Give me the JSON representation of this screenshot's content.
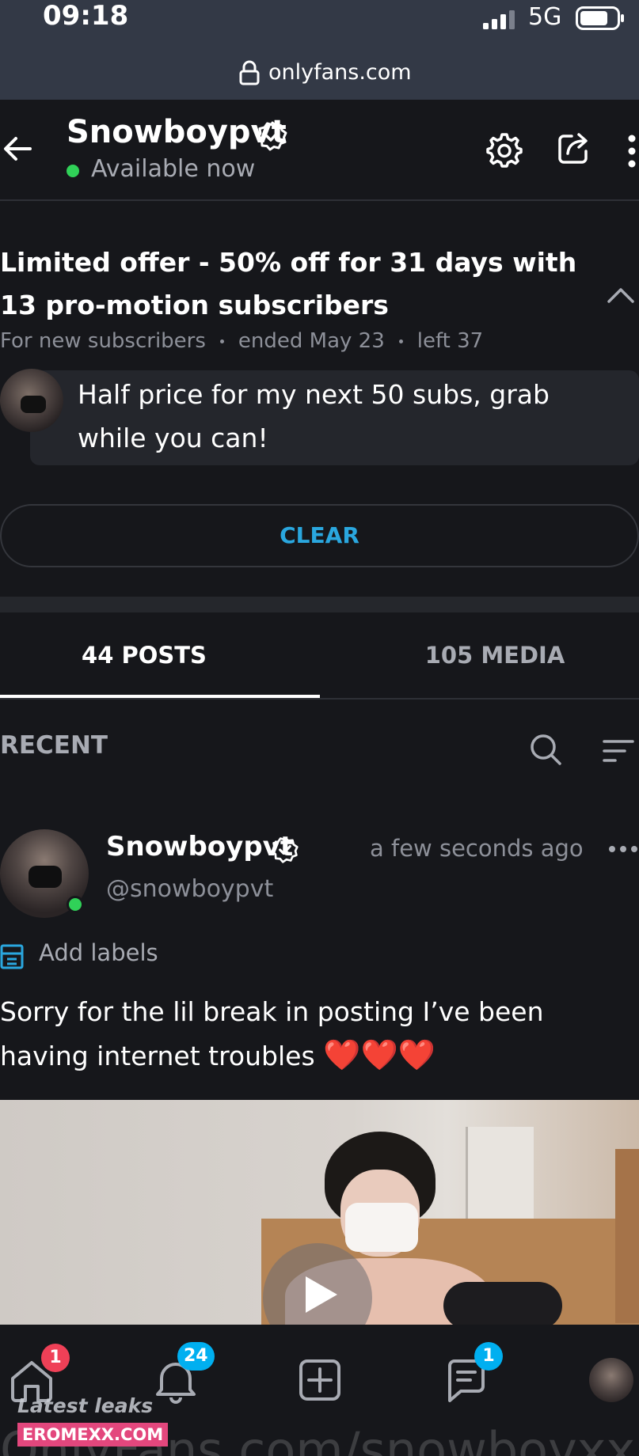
{
  "status_bar": {
    "time": "09:18",
    "network": "5G"
  },
  "browser": {
    "url": "onlyfans.com"
  },
  "header": {
    "name": "Snowboypvt",
    "availability": "Available now"
  },
  "offer": {
    "title": "Limited offer - 50% off for 31 days with 13 pro-motion subscribers",
    "meta": [
      "For new subscribers",
      "ended May 23",
      "left 37"
    ],
    "message": "Half price for my next 50 subs, grab while you can!",
    "clear_label": "CLEAR"
  },
  "tabs": [
    {
      "label": "44 POSTS",
      "active": true
    },
    {
      "label": "105 MEDIA",
      "active": false
    }
  ],
  "feed": {
    "section_label": "RECENT"
  },
  "post": {
    "author": "Snowboypvt",
    "handle": "@snowboypvt",
    "time": "a few seconds ago",
    "add_labels": "Add labels",
    "text": "Sorry for the lil break in posting I’ve been having internet troubles",
    "emoji": "❤️❤️❤️"
  },
  "nav": {
    "home_badge": "1",
    "notifications_badge": "24",
    "messages_badge": "1"
  },
  "watermark": {
    "label": "Latest leaks",
    "site": "EROMEXX.COM",
    "overlay_url": "OnlyFans.com/snowboyxx"
  },
  "colors": {
    "accent": "#00aff0",
    "clear_text": "#2aa7df",
    "online": "#30d158",
    "badge_red": "#ef4057",
    "heart": "#e0262f",
    "background": "#16171b"
  },
  "icons": [
    "lock-icon",
    "back-arrow-icon",
    "verified-icon",
    "settings-icon",
    "share-icon",
    "more-vertical-icon",
    "chevron-up-icon",
    "search-icon",
    "sort-icon",
    "label-icon",
    "more-horizontal-icon",
    "play-icon",
    "home-icon",
    "bell-icon",
    "add-post-icon",
    "messages-icon"
  ]
}
